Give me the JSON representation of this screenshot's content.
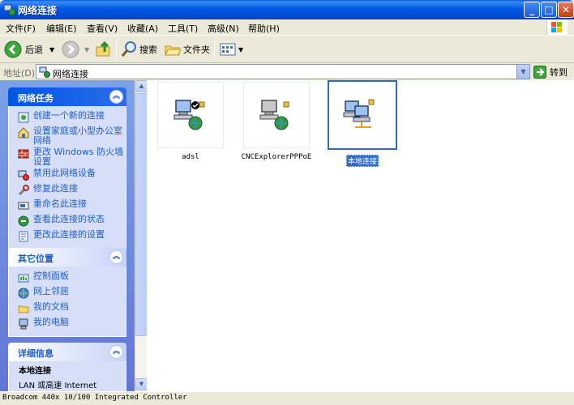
{
  "window": {
    "title": "网络连接"
  },
  "menu": [
    "文件(F)",
    "编辑(E)",
    "查看(V)",
    "收藏(A)",
    "工具(T)",
    "高级(N)",
    "帮助(H)"
  ],
  "toolbar": {
    "back": "后退",
    "search": "搜索",
    "folders": "文件夹"
  },
  "address": {
    "label": "地址(D)",
    "value": "网络连接",
    "go": "转到"
  },
  "network_tasks": {
    "title": "网络任务",
    "items": [
      {
        "label": "创建一个新的连接",
        "icon": "new-connection-icon"
      },
      {
        "label": "设置家庭或小型办公室网络",
        "icon": "home-network-icon"
      },
      {
        "label": "更改 Windows 防火墙设置",
        "icon": "firewall-icon"
      },
      {
        "label": "禁用此网络设备",
        "icon": "disable-device-icon"
      },
      {
        "label": "修复此连接",
        "icon": "repair-icon"
      },
      {
        "label": "重命名此连接",
        "icon": "rename-icon"
      },
      {
        "label": "查看此连接的状态",
        "icon": "status-icon"
      },
      {
        "label": "更改此连接的设置",
        "icon": "settings-icon"
      }
    ]
  },
  "other_places": {
    "title": "其它位置",
    "items": [
      {
        "label": "控制面板",
        "icon": "control-panel-icon"
      },
      {
        "label": "网上邻居",
        "icon": "network-places-icon"
      },
      {
        "label": "我的文档",
        "icon": "my-documents-icon"
      },
      {
        "label": "我的电脑",
        "icon": "my-computer-icon"
      }
    ]
  },
  "details": {
    "title": "详细信息",
    "name": "本地连接",
    "type": "LAN 或高速 Internet"
  },
  "connections": [
    {
      "label": "adsl",
      "icon": "dialup-connection-icon",
      "selected": false
    },
    {
      "label": "CNCExplorerPPPoE",
      "icon": "dialup-connection-icon",
      "selected": false
    },
    {
      "label": "本地连接",
      "icon": "lan-connection-icon",
      "selected": true
    }
  ],
  "status": {
    "text": "Broadcom 440x 10/100 Integrated Controller"
  },
  "colors": {
    "title_bar": "#0058e6",
    "task_pane": "#7ba2e7",
    "link": "#215dc6",
    "selection": "#316ac5"
  }
}
